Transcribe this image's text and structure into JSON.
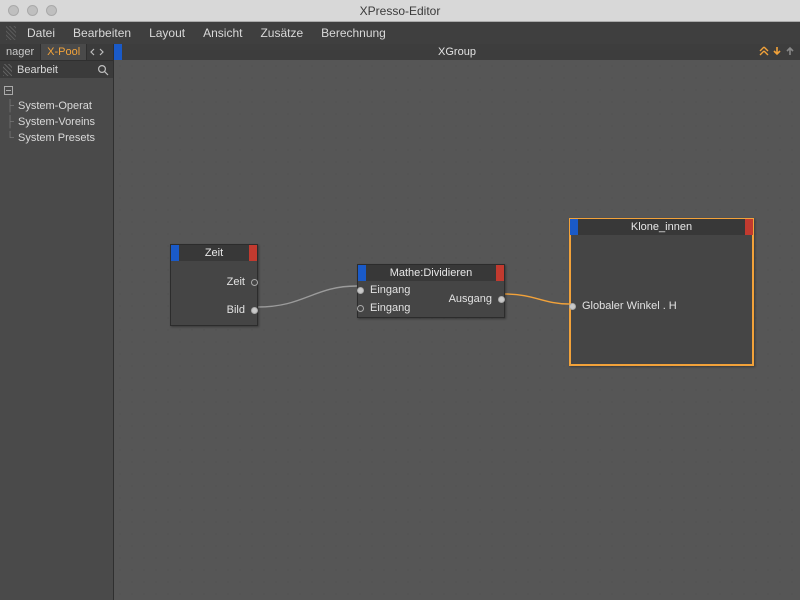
{
  "window": {
    "title": "XPresso-Editor"
  },
  "menus": [
    "Datei",
    "Bearbeiten",
    "Layout",
    "Ansicht",
    "Zusätze",
    "Berechnung"
  ],
  "sidebar": {
    "tabs": {
      "inactive": "nager",
      "active": "X-Pool"
    },
    "filter_label": "Bearbeit",
    "tree": [
      {
        "label": ""
      },
      {
        "label": "System-Operat"
      },
      {
        "label": "System-Voreins"
      },
      {
        "label": "System Presets"
      }
    ]
  },
  "canvas": {
    "header_title": "XGroup"
  },
  "nodes": {
    "zeit": {
      "title": "Zeit",
      "out0": "Zeit",
      "out1": "Bild"
    },
    "mathe": {
      "title": "Mathe:Dividieren",
      "in_label": "Eingang",
      "out_label": "Ausgang"
    },
    "klone": {
      "title": "Klone_innen",
      "in0": "Globaler Winkel . H"
    }
  }
}
